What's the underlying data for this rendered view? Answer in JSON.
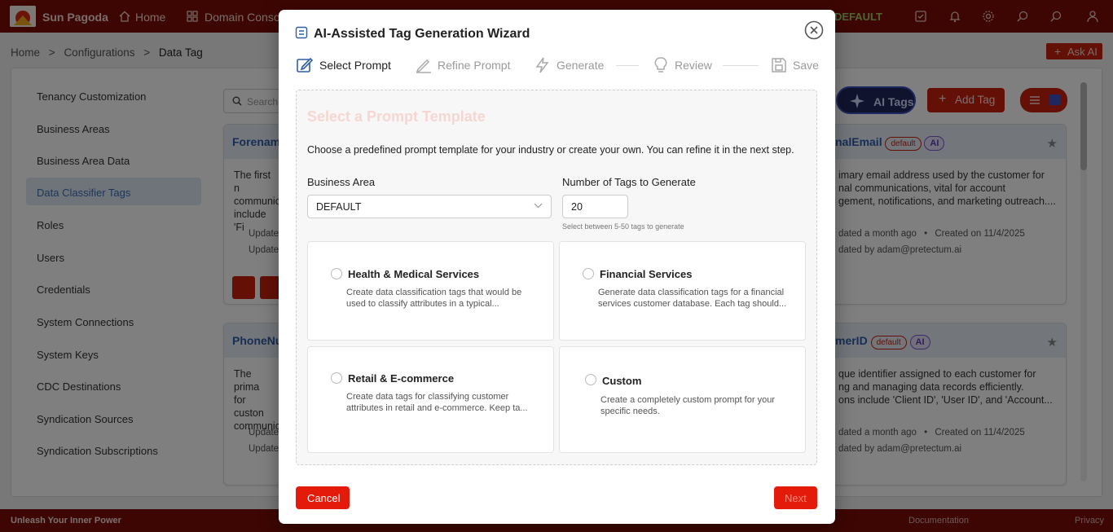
{
  "topbar": {
    "brand": "Sun Pagoda",
    "nav": [
      "Home",
      "Domain Console"
    ],
    "default_label": "DEFAULT",
    "icons": [
      "checkbox-icon",
      "bell-icon",
      "gear-icon",
      "search-alt-icon",
      "search-icon",
      "user-icon"
    ]
  },
  "breadcrumb": [
    "Home",
    ">",
    "Configurations",
    ">",
    "Data Tag"
  ],
  "ask_ai": "Ask AI",
  "sidebar": {
    "items": [
      {
        "label": "Tenancy Customization"
      },
      {
        "label": "Business Areas"
      },
      {
        "label": "Business Area Data"
      },
      {
        "label": "Data Classifier Tags",
        "active": true
      },
      {
        "label": "Roles"
      },
      {
        "label": "Users"
      },
      {
        "label": "Credentials"
      },
      {
        "label": "System Connections"
      },
      {
        "label": "System Keys"
      },
      {
        "label": "CDC Destinations"
      },
      {
        "label": "Syndication Sources"
      },
      {
        "label": "Syndication Subscriptions"
      }
    ]
  },
  "toolbar": {
    "search_placeholder": "Search",
    "ai_tags": "AI Tags",
    "add_tag": "Add Tag"
  },
  "cards": {
    "left_top": {
      "title": "Forename",
      "desc": [
        "The first n",
        "communic",
        "include 'Fi"
      ],
      "updated": "Update",
      "updated_by": "Update"
    },
    "left_bottom": {
      "title": "PhoneNu",
      "desc": [
        "The prima",
        "for custon",
        "communic"
      ],
      "updated": "Update",
      "updated_by": "Update"
    },
    "right_top": {
      "title": "nalEmail",
      "badge": "default",
      "ai": "AI",
      "desc": [
        "imary email address used by the customer for",
        "nal communications, vital for account",
        "gement, notifications, and marketing outreach...."
      ],
      "updated": "dated a month ago",
      "created": "Created on 11/4/2025",
      "updated_by": "dated by adam@pretectum.ai"
    },
    "right_bottom": {
      "title": "merID",
      "badge": "default",
      "ai": "AI",
      "desc": [
        "que identifier assigned to each customer for",
        "ng and managing data records efficiently.",
        "ons include 'Client ID', 'User ID', and 'Account..."
      ],
      "updated": "dated a month ago",
      "created": "Created on 11/4/2025",
      "updated_by": "dated by adam@pretectum.ai"
    }
  },
  "footer": {
    "tagline": "Unleash Your Inner Power",
    "documentation": "Documentation",
    "privacy": "Privacy"
  },
  "modal": {
    "title": "AI-Assisted Tag Generation Wizard",
    "steps": [
      {
        "label": "Select Prompt",
        "icon": "edit-icon",
        "active": true
      },
      {
        "label": "Refine Prompt",
        "icon": "pen-icon",
        "active": false
      },
      {
        "label": "Generate",
        "icon": "lightning-icon",
        "active": false
      },
      {
        "label": "Review",
        "icon": "bulb-icon",
        "active": false
      },
      {
        "label": "Save",
        "icon": "save-icon",
        "active": false
      }
    ],
    "section_title": "Select a Prompt Template",
    "section_desc": "Choose a predefined prompt template for your industry or create your own. You can refine it in the next step.",
    "business_area_label": "Business Area",
    "business_area_value": "DEFAULT",
    "num_tags_label": "Number of Tags to Generate",
    "num_tags_value": "20",
    "num_tags_hint": "Select between 5-50 tags to generate",
    "templates": [
      {
        "title": "Health & Medical Services",
        "desc": [
          "Create data classification tags that would be",
          "used to classify attributes in a typical..."
        ]
      },
      {
        "title": "Financial Services",
        "desc": [
          "Generate data classification tags for a financial",
          "services customer database. Each tag should..."
        ]
      },
      {
        "title": "Retail & E-commerce",
        "desc": [
          "Create data tags for classifying customer",
          "attributes in retail and e-commerce. Keep ta..."
        ]
      },
      {
        "title": "Custom",
        "desc": [
          "Create a completely custom prompt for your",
          "specific needs."
        ]
      }
    ],
    "cancel": "Cancel",
    "next": "Next"
  },
  "colors": {
    "brand_dark": "#7a0c04",
    "accent_red": "#e41a0b",
    "link_blue": "#2f5da8",
    "ai_purple": "#5a3db8"
  }
}
